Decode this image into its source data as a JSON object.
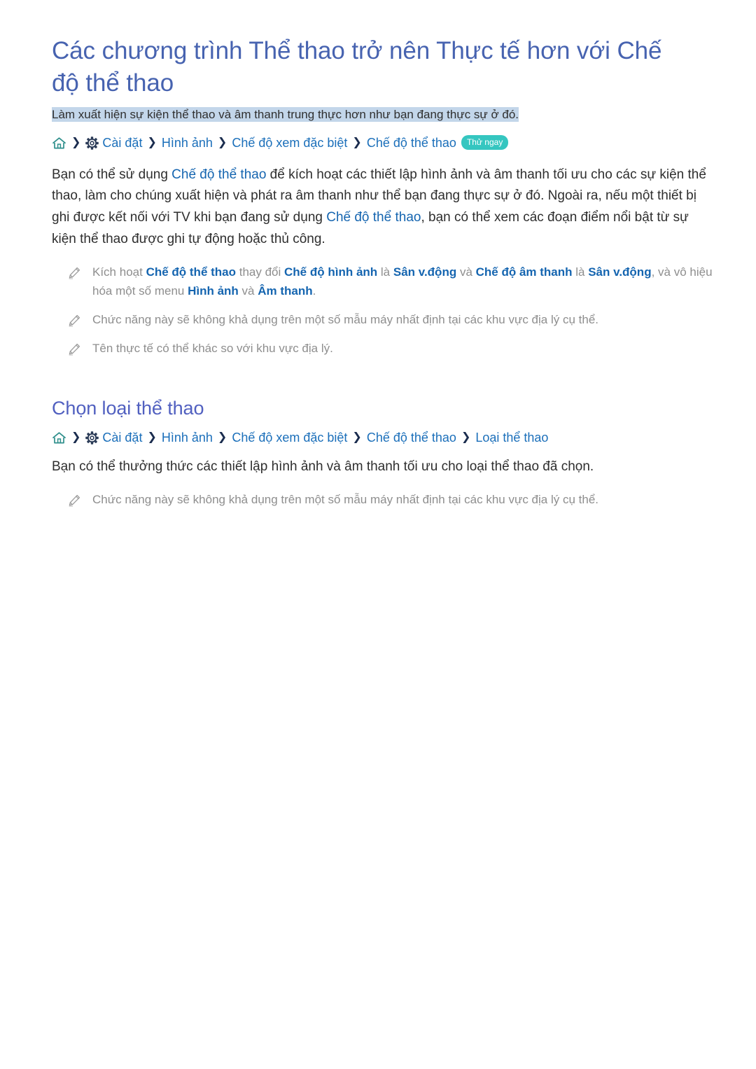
{
  "document": {
    "title": "Các chương trình Thể thao trở nên Thực tế hơn với Chế độ thể thao",
    "subtitle": "Làm xuất hiện sự kiện thể thao và âm thanh trung thực hơn như bạn đang thực sự ở đó."
  },
  "colors": {
    "title": "#4763b0",
    "section_title": "#5160c0",
    "link": "#1565b0",
    "breadcrumb": "#1b6fba",
    "badge_bg": "#35c6c0",
    "subtitle_highlight": "#c3d6ea",
    "note_text": "#8e8e8e",
    "home_icon": "#2f8f8c",
    "separator": "#1a2c4e"
  },
  "breadcrumb_1": {
    "home_icon": "home-icon",
    "gear_icon": "gear-icon",
    "separator": "❯",
    "items": [
      "Cài đặt",
      "Hình ảnh",
      "Chế độ xem đặc biệt",
      "Chế độ thể thao"
    ],
    "badge": "Thử ngay"
  },
  "body": {
    "paragraph_1": {
      "part_1": "Bạn có thể sử dụng ",
      "link_1": "Chế độ thể thao",
      "part_2": " để kích hoạt các thiết lập hình ảnh và âm thanh tối ưu cho các sự kiện thể thao, làm cho chúng xuất hiện và phát ra âm thanh như thể bạn đang thực sự ở đó. Ngoài ra, nếu một thiết bị ghi được kết nối với TV khi bạn đang sử dụng ",
      "link_2": "Chế độ thể thao",
      "part_3": ", bạn có thể xem các đoạn điểm nổi bật từ sự kiện thể thao được ghi tự động hoặc thủ công."
    }
  },
  "notes_1": [
    {
      "icon": "pencil-icon",
      "segments": [
        {
          "t": "Kích hoạt ",
          "bold": false
        },
        {
          "t": "Chế độ thể thao",
          "bold": true
        },
        {
          "t": " thay đổi ",
          "bold": false
        },
        {
          "t": "Chế độ hình ảnh",
          "bold": true
        },
        {
          "t": " là ",
          "bold": false
        },
        {
          "t": "Sân v.động",
          "bold": true
        },
        {
          "t": " và ",
          "bold": false
        },
        {
          "t": "Chế độ âm thanh",
          "bold": true
        },
        {
          "t": " là ",
          "bold": false
        },
        {
          "t": "Sân v.động",
          "bold": true
        },
        {
          "t": ", và vô hiệu hóa một số menu ",
          "bold": false
        },
        {
          "t": "Hình ảnh",
          "bold": true
        },
        {
          "t": " và ",
          "bold": false
        },
        {
          "t": "Âm thanh",
          "bold": true
        },
        {
          "t": ".",
          "bold": false
        }
      ]
    },
    {
      "icon": "pencil-icon",
      "segments": [
        {
          "t": "Chức năng này sẽ không khả dụng trên một số mẫu máy nhất định tại các khu vực địa lý cụ thể.",
          "bold": false
        }
      ]
    },
    {
      "icon": "pencil-icon",
      "segments": [
        {
          "t": "Tên thực tế có thể khác so với khu vực địa lý.",
          "bold": false
        }
      ]
    }
  ],
  "section_2": {
    "title": "Chọn loại thể thao",
    "breadcrumb": {
      "home_icon": "home-icon",
      "gear_icon": "gear-icon",
      "separator": "❯",
      "items": [
        "Cài đặt",
        "Hình ảnh",
        "Chế độ xem đặc biệt",
        "Chế độ thể thao",
        "Loại thể thao"
      ]
    },
    "paragraph": "Bạn có thể thưởng thức các thiết lập hình ảnh và âm thanh tối ưu cho loại thể thao đã chọn.",
    "notes": [
      {
        "icon": "pencil-icon",
        "segments": [
          {
            "t": "Chức năng này sẽ không khả dụng trên một số mẫu máy nhất định tại các khu vực địa lý cụ thể.",
            "bold": false
          }
        ]
      }
    ]
  }
}
